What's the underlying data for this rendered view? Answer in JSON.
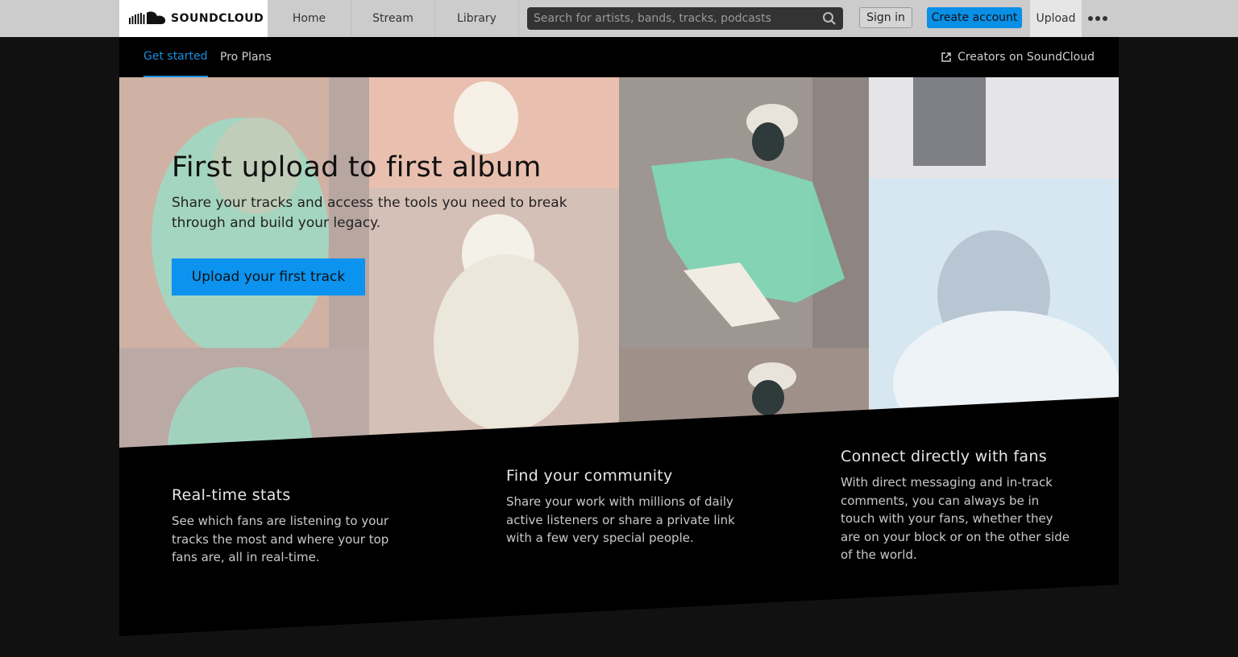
{
  "header": {
    "logo_text": "SOUNDCLOUD",
    "nav": [
      {
        "label": "Home"
      },
      {
        "label": "Stream"
      },
      {
        "label": "Library"
      }
    ],
    "search_placeholder": "Search for artists, bands, tracks, podcasts",
    "signin_label": "Sign in",
    "create_label": "Create account",
    "upload_label": "Upload",
    "more_icon": "more-dots-icon"
  },
  "subnav": {
    "tabs": [
      {
        "label": "Get started",
        "active": true
      },
      {
        "label": "Pro Plans",
        "active": false
      }
    ],
    "creators_label": "Creators on SoundCloud"
  },
  "hero": {
    "title": "First upload to first album",
    "subtitle": "Share your tracks and access the tools you need to break through and build your legacy.",
    "cta_label": "Upload your first track"
  },
  "features": [
    {
      "title": "Real-time stats",
      "text": "See which fans are listening to your tracks the most and where your top fans are, all in real-time."
    },
    {
      "title": "Find your community",
      "text": "Share your work with millions of daily active listeners or share a private link with a few very special people."
    },
    {
      "title": "Connect directly with fans",
      "text": "With direct messaging and in-track comments, you can always be in touch with your fans, whether they are on your block or on the other side of the world."
    }
  ],
  "colors": {
    "accent": "#0b93ef",
    "link_active": "#1a8fe0",
    "header_bg": "#cccccc",
    "page_bg": "#111111"
  }
}
